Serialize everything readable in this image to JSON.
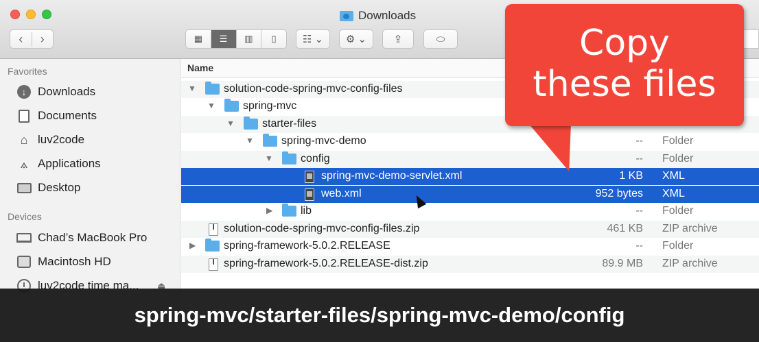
{
  "window": {
    "title": "Downloads"
  },
  "toolbar": {
    "back_glyph": "‹",
    "forward_glyph": "›",
    "views": [
      "icon-view",
      "list-view",
      "column-view",
      "coverflow-view"
    ],
    "active_view": "list-view",
    "arrange_glyph": "☷ ⌄",
    "action_glyph": "⚙ ⌄",
    "share_glyph": "⇪",
    "tag_glyph": "⬭"
  },
  "sidebar": {
    "favorites_heading": "Favorites",
    "favorites": [
      {
        "label": "Downloads",
        "icon": "download-icon"
      },
      {
        "label": "Documents",
        "icon": "documents-icon"
      },
      {
        "label": "luv2code",
        "icon": "home-icon"
      },
      {
        "label": "Applications",
        "icon": "applications-icon"
      },
      {
        "label": "Desktop",
        "icon": "desktop-icon"
      }
    ],
    "devices_heading": "Devices",
    "devices": [
      {
        "label": "Chad’s MacBook Pro",
        "icon": "laptop-icon"
      },
      {
        "label": "Macintosh HD",
        "icon": "disk-icon"
      },
      {
        "label": "luv2code time ma...",
        "icon": "time-machine-icon"
      }
    ]
  },
  "list": {
    "name_header": "Name",
    "rows": [
      {
        "name": "solution-code-spring-mvc-config-files",
        "size": "",
        "kind": ""
      },
      {
        "name": "spring-mvc",
        "size": "",
        "kind": ""
      },
      {
        "name": "starter-files",
        "size": "",
        "kind": ""
      },
      {
        "name": "spring-mvc-demo",
        "size": "--",
        "kind": "Folder"
      },
      {
        "name": "config",
        "size": "--",
        "kind": "Folder"
      },
      {
        "name": "spring-mvc-demo-servlet.xml",
        "size": "1 KB",
        "kind": "XML"
      },
      {
        "name": "web.xml",
        "size": "952 bytes",
        "kind": "XML"
      },
      {
        "name": "lib",
        "size": "--",
        "kind": "Folder"
      },
      {
        "name": "solution-code-spring-mvc-config-files.zip",
        "size": "461 KB",
        "kind": "ZIP archive"
      },
      {
        "name": "spring-framework-5.0.2.RELEASE",
        "size": "--",
        "kind": "Folder"
      },
      {
        "name": "spring-framework-5.0.2.RELEASE-dist.zip",
        "size": "89.9 MB",
        "kind": "ZIP archive"
      }
    ]
  },
  "callout": {
    "line1": "Copy",
    "line2": "these files",
    "color": "#f2453a"
  },
  "caption": {
    "text": "spring-mvc/starter-files/spring-mvc-demo/config"
  },
  "colors": {
    "selection": "#1b5fd0",
    "folder": "#5aaeea"
  }
}
